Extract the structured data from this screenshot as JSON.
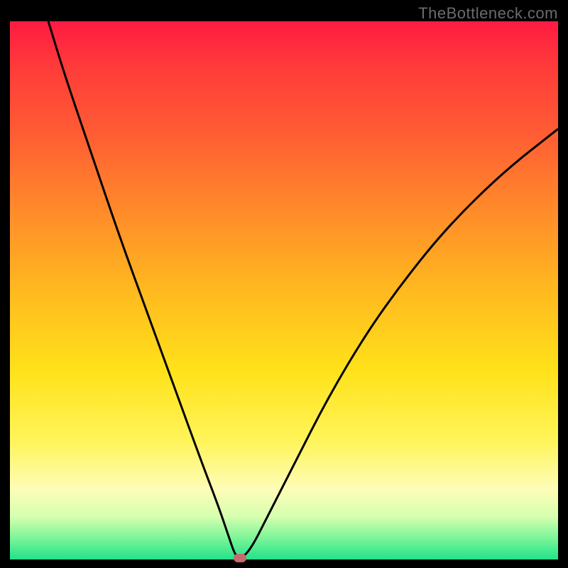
{
  "watermark": "TheBottleneck.com",
  "chart_data": {
    "type": "line",
    "title": "",
    "xlabel": "",
    "ylabel": "",
    "xlim": [
      0,
      100
    ],
    "ylim": [
      0,
      100
    ],
    "grid": false,
    "legend": false,
    "background": "gradient red→orange→yellow→green (top→bottom)",
    "series": [
      {
        "name": "curve",
        "color": "#000000",
        "x": [
          7,
          10,
          15,
          20,
          25,
          30,
          35,
          38,
          40,
          41,
          42,
          44,
          47,
          52,
          58,
          65,
          72,
          80,
          90,
          100
        ],
        "values": [
          100,
          90,
          75,
          60,
          46,
          32,
          18,
          10,
          4,
          1,
          0,
          2,
          8,
          18,
          30,
          42,
          52,
          62,
          72,
          80
        ]
      }
    ],
    "marker": {
      "x": 42,
      "y": 0,
      "color": "#c76a6c",
      "shape": "rounded-pill"
    }
  }
}
